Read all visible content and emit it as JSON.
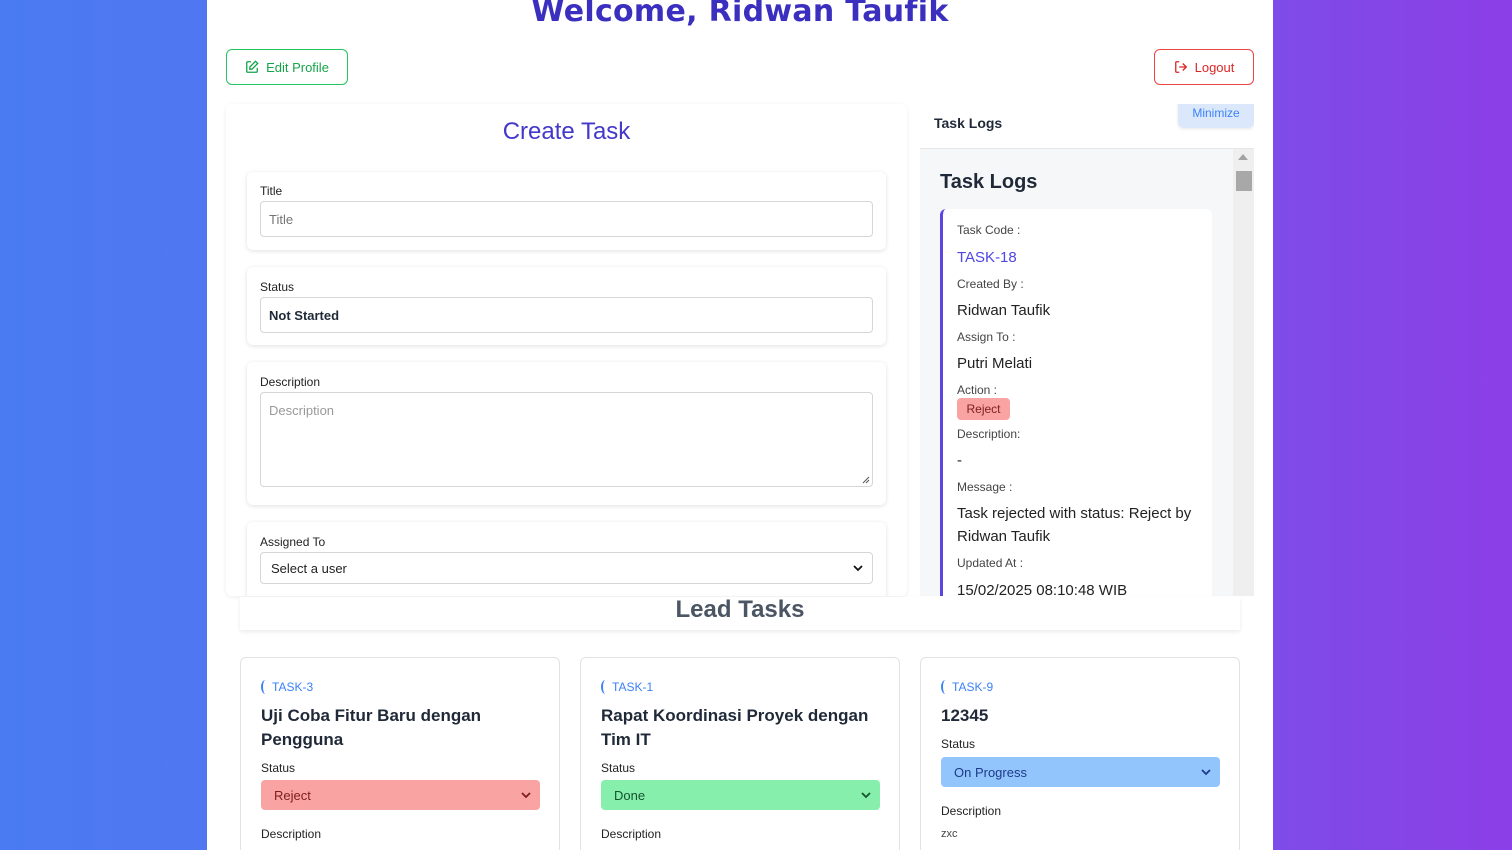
{
  "header": {
    "welcome": "Welcome, Ridwan Taufik",
    "edit_profile_label": "Edit Profile",
    "logout_label": "Logout"
  },
  "create_task": {
    "title": "Create Task",
    "title_field": {
      "label": "Title",
      "placeholder": "Title"
    },
    "status_field": {
      "label": "Status",
      "value": "Not Started"
    },
    "description_field": {
      "label": "Description",
      "placeholder": "Description"
    },
    "assigned_field": {
      "label": "Assigned To",
      "value": "Select a user"
    }
  },
  "task_logs": {
    "header_title": "Task Logs",
    "minimize_label": "Minimize",
    "title": "Task Logs",
    "entry": {
      "task_code_label": "Task Code :",
      "task_code": "TASK-18",
      "created_by_label": "Created By :",
      "created_by": "Ridwan Taufik",
      "assign_to_label": "Assign To :",
      "assign_to": "Putri Melati",
      "action_label": "Action :",
      "action": "Reject",
      "description_label": "Description:",
      "description": "-",
      "message_label": "Message :",
      "message": "Task rejected with status: Reject by Ridwan Taufik",
      "updated_at_label": "Updated At :",
      "updated_at": "15/02/2025 08:10:48 WIB"
    }
  },
  "lead_tasks": {
    "title": "Lead Tasks",
    "cards": [
      {
        "code": "TASK-3",
        "title": "Uji Coba Fitur Baru dengan Pengguna",
        "status_label": "Status",
        "status": "Reject",
        "description_label": "Description",
        "description": ""
      },
      {
        "code": "TASK-1",
        "title": "Rapat Koordinasi Proyek dengan Tim IT",
        "status_label": "Status",
        "status": "Done",
        "description_label": "Description",
        "description": ""
      },
      {
        "code": "TASK-9",
        "title": "12345",
        "status_label": "Status",
        "status": "On Progress",
        "description_label": "Description",
        "description": "zxc"
      }
    ]
  },
  "colors": {
    "accent": "#4338ca",
    "reject": "#f9a3a3",
    "done": "#86efac",
    "on_progress": "#93c5fd"
  }
}
